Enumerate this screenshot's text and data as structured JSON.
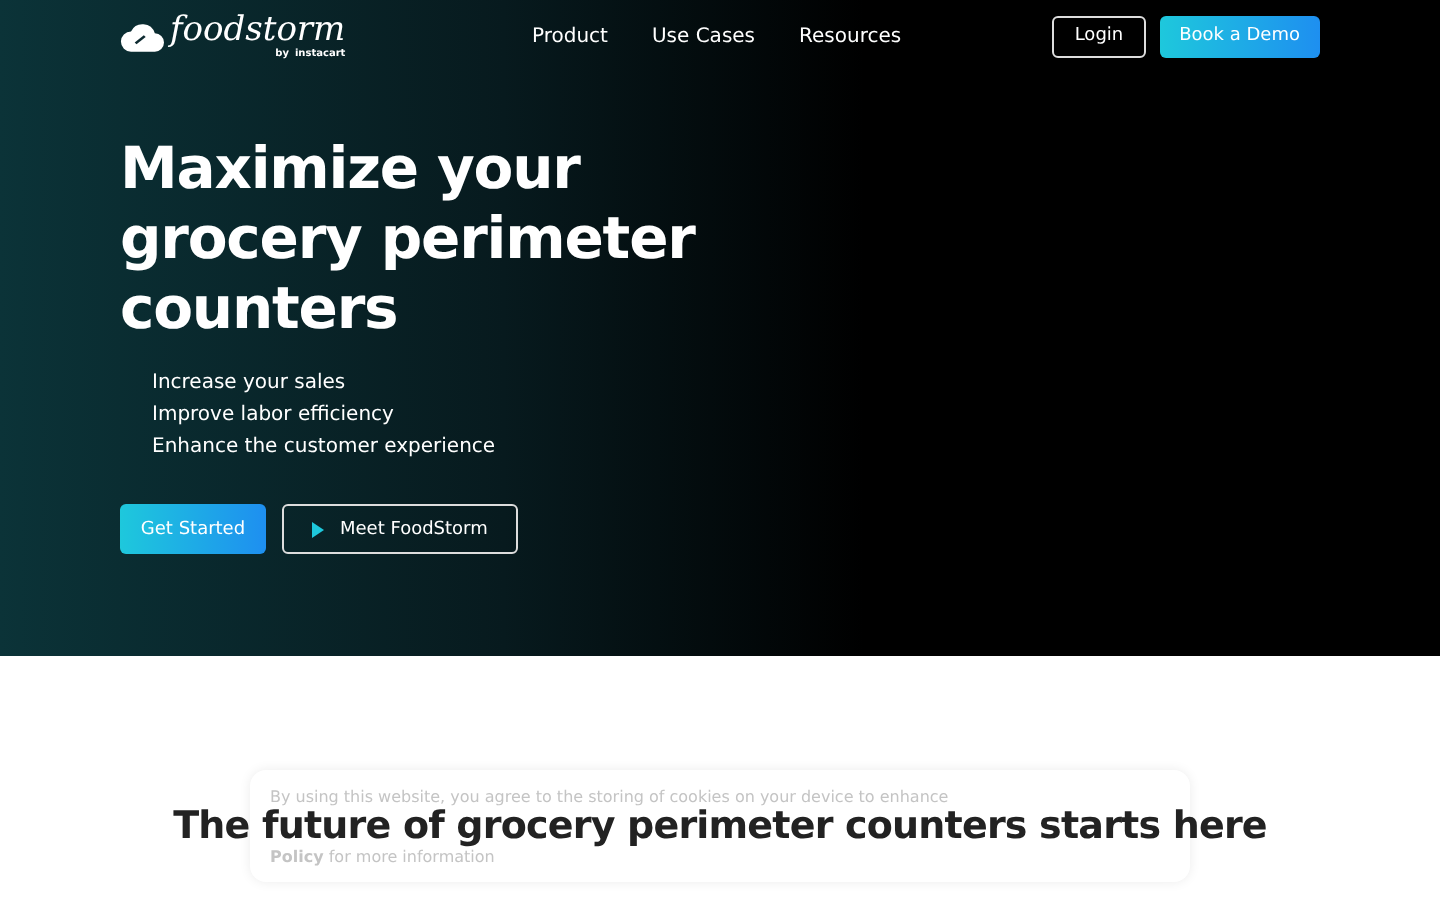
{
  "logo": {
    "name": "foodstorm",
    "byline": "by",
    "partner": "instacart"
  },
  "nav": [
    {
      "label": "Product"
    },
    {
      "label": "Use Cases"
    },
    {
      "label": "Resources"
    }
  ],
  "actions": {
    "login": "Login",
    "demo": "Book a Demo"
  },
  "hero": {
    "title": "Maximize your grocery perimeter counters",
    "bullets": [
      "Increase your sales",
      "Improve labor efficiency",
      "Enhance the customer experience"
    ],
    "primary": "Get Started",
    "secondary": "Meet FoodStorm"
  },
  "section": {
    "heading": "The future of grocery perimeter counters starts here"
  },
  "cookie_banner": {
    "line_1": "By using this website, you agree to the storing of cookies on your device to enhance",
    "line_3": "**Policy** for more information"
  }
}
